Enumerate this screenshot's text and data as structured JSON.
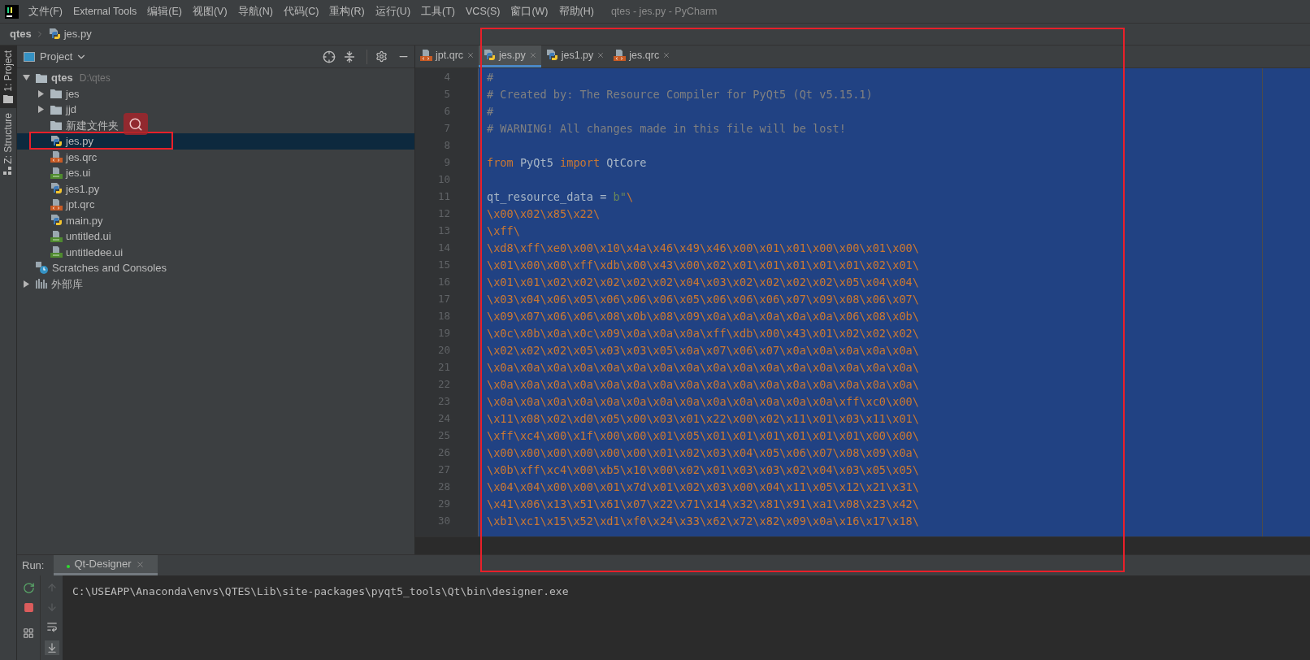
{
  "menu_bar": {
    "items": [
      "文件(F)",
      "External Tools",
      "编辑(E)",
      "视图(V)",
      "导航(N)",
      "代码(C)",
      "重构(R)",
      "运行(U)",
      "工具(T)",
      "VCS(S)",
      "窗口(W)",
      "帮助(H)"
    ],
    "title": "qtes - jes.py - PyCharm"
  },
  "breadcrumb": [
    {
      "kind": "folder",
      "label": "qtes"
    },
    {
      "kind": "python",
      "label": "jes.py"
    }
  ],
  "tool_strip": [
    {
      "label": "1: Project",
      "selected": true
    },
    {
      "label": "Z: Structure",
      "selected": false
    }
  ],
  "project": {
    "title": "Project",
    "tree": [
      {
        "kind": "folder",
        "label": "qtes",
        "hint": "D:\\qtes",
        "expanded": true,
        "selected": false,
        "children": [
          {
            "kind": "folder",
            "label": "jes",
            "expanded": false,
            "selected": false
          },
          {
            "kind": "folder",
            "label": "jjd",
            "expanded": false,
            "selected": false
          },
          {
            "kind": "folder",
            "label": "新建文件夹",
            "selected": false
          },
          {
            "kind": "python",
            "label": "jes.py",
            "selected": true
          },
          {
            "kind": "qrc",
            "label": "jes.qrc",
            "selected": false
          },
          {
            "kind": "ui",
            "label": "jes.ui",
            "selected": false
          },
          {
            "kind": "python",
            "label": "jes1.py",
            "selected": false
          },
          {
            "kind": "qrc",
            "label": "jpt.qrc",
            "selected": false
          },
          {
            "kind": "python",
            "label": "main.py",
            "selected": false
          },
          {
            "kind": "ui",
            "label": "untitled.ui",
            "selected": false
          },
          {
            "kind": "ui",
            "label": "untitledee.ui",
            "selected": false
          }
        ]
      },
      {
        "kind": "scratches",
        "label": "Scratches and Consoles",
        "selected": false
      },
      {
        "kind": "library",
        "label": "外部库",
        "expanded": false,
        "selected": false
      }
    ]
  },
  "editor": {
    "tabs": [
      {
        "kind": "qrc",
        "label": "jpt.qrc",
        "selected": false
      },
      {
        "kind": "python",
        "label": "jes.py",
        "selected": true
      },
      {
        "kind": "python",
        "label": "jes1.py",
        "selected": false
      },
      {
        "kind": "qrc",
        "label": "jes.qrc",
        "selected": false
      }
    ],
    "lines": [
      {
        "number": "4",
        "tokens": [
          {
            "kind": "comment",
            "text": "#"
          }
        ]
      },
      {
        "number": "5",
        "tokens": [
          {
            "kind": "comment",
            "text": "# Created by: The Resource Compiler for PyQt5 (Qt v5.15.1)"
          }
        ]
      },
      {
        "number": "6",
        "tokens": [
          {
            "kind": "comment",
            "text": "#"
          }
        ]
      },
      {
        "number": "7",
        "tokens": [
          {
            "kind": "comment",
            "text": "# WARNING! All changes made in this file will be lost!"
          }
        ]
      },
      {
        "number": "8"
      },
      {
        "number": "9",
        "tokens": [
          {
            "kind": "keyword",
            "text": "from"
          },
          {
            "kind": "plain",
            "text": " PyQt5 "
          },
          {
            "kind": "keyword",
            "text": "import"
          },
          {
            "kind": "plain",
            "text": " QtCore"
          }
        ]
      },
      {
        "number": "10"
      },
      {
        "number": "11",
        "tokens": [
          {
            "kind": "plain",
            "text": "qt_resource_data = "
          },
          {
            "kind": "string",
            "text": "b\""
          },
          {
            "kind": "escape",
            "text": "\\"
          }
        ]
      },
      {
        "number": "12",
        "tokens": [
          {
            "kind": "escape",
            "text": "\\x00\\x02\\x85\\x22\\"
          }
        ]
      },
      {
        "number": "13",
        "tokens": [
          {
            "kind": "escape",
            "text": "\\xff\\"
          }
        ]
      },
      {
        "number": "14",
        "tokens": [
          {
            "kind": "escape",
            "text": "\\xd8\\xff\\xe0\\x00\\x10\\x4a\\x46\\x49\\x46\\x00\\x01\\x01\\x00\\x00\\x01\\x00\\"
          }
        ]
      },
      {
        "number": "15",
        "tokens": [
          {
            "kind": "escape",
            "text": "\\x01\\x00\\x00\\xff\\xdb\\x00\\x43\\x00\\x02\\x01\\x01\\x01\\x01\\x01\\x02\\x01\\"
          }
        ]
      },
      {
        "number": "16",
        "tokens": [
          {
            "kind": "escape",
            "text": "\\x01\\x01\\x02\\x02\\x02\\x02\\x02\\x04\\x03\\x02\\x02\\x02\\x02\\x05\\x04\\x04\\"
          }
        ]
      },
      {
        "number": "17",
        "tokens": [
          {
            "kind": "escape",
            "text": "\\x03\\x04\\x06\\x05\\x06\\x06\\x06\\x05\\x06\\x06\\x06\\x07\\x09\\x08\\x06\\x07\\"
          }
        ]
      },
      {
        "number": "18",
        "tokens": [
          {
            "kind": "escape",
            "text": "\\x09\\x07\\x06\\x06\\x08\\x0b\\x08\\x09\\x0a\\x0a\\x0a\\x0a\\x0a\\x06\\x08\\x0b\\"
          }
        ]
      },
      {
        "number": "19",
        "tokens": [
          {
            "kind": "escape",
            "text": "\\x0c\\x0b\\x0a\\x0c\\x09\\x0a\\x0a\\x0a\\xff\\xdb\\x00\\x43\\x01\\x02\\x02\\x02\\"
          }
        ]
      },
      {
        "number": "20",
        "tokens": [
          {
            "kind": "escape",
            "text": "\\x02\\x02\\x02\\x05\\x03\\x03\\x05\\x0a\\x07\\x06\\x07\\x0a\\x0a\\x0a\\x0a\\x0a\\"
          }
        ]
      },
      {
        "number": "21",
        "tokens": [
          {
            "kind": "escape",
            "text": "\\x0a\\x0a\\x0a\\x0a\\x0a\\x0a\\x0a\\x0a\\x0a\\x0a\\x0a\\x0a\\x0a\\x0a\\x0a\\x0a\\"
          }
        ]
      },
      {
        "number": "22",
        "tokens": [
          {
            "kind": "escape",
            "text": "\\x0a\\x0a\\x0a\\x0a\\x0a\\x0a\\x0a\\x0a\\x0a\\x0a\\x0a\\x0a\\x0a\\x0a\\x0a\\x0a\\"
          }
        ]
      },
      {
        "number": "23",
        "tokens": [
          {
            "kind": "escape",
            "text": "\\x0a\\x0a\\x0a\\x0a\\x0a\\x0a\\x0a\\x0a\\x0a\\x0a\\x0a\\x0a\\x0a\\xff\\xc0\\x00\\"
          }
        ]
      },
      {
        "number": "24",
        "tokens": [
          {
            "kind": "escape",
            "text": "\\x11\\x08\\x02\\xd0\\x05\\x00\\x03\\x01\\x22\\x00\\x02\\x11\\x01\\x03\\x11\\x01\\"
          }
        ]
      },
      {
        "number": "25",
        "tokens": [
          {
            "kind": "escape",
            "text": "\\xff\\xc4\\x00\\x1f\\x00\\x00\\x01\\x05\\x01\\x01\\x01\\x01\\x01\\x01\\x00\\x00\\"
          }
        ]
      },
      {
        "number": "26",
        "tokens": [
          {
            "kind": "escape",
            "text": "\\x00\\x00\\x00\\x00\\x00\\x00\\x01\\x02\\x03\\x04\\x05\\x06\\x07\\x08\\x09\\x0a\\"
          }
        ]
      },
      {
        "number": "27",
        "tokens": [
          {
            "kind": "escape",
            "text": "\\x0b\\xff\\xc4\\x00\\xb5\\x10\\x00\\x02\\x01\\x03\\x03\\x02\\x04\\x03\\x05\\x05\\"
          }
        ]
      },
      {
        "number": "28",
        "tokens": [
          {
            "kind": "escape",
            "text": "\\x04\\x04\\x00\\x00\\x01\\x7d\\x01\\x02\\x03\\x00\\x04\\x11\\x05\\x12\\x21\\x31\\"
          }
        ]
      },
      {
        "number": "29",
        "tokens": [
          {
            "kind": "escape",
            "text": "\\x41\\x06\\x13\\x51\\x61\\x07\\x22\\x71\\x14\\x32\\x81\\x91\\xa1\\x08\\x23\\x42\\"
          }
        ]
      },
      {
        "number": "30",
        "tokens": [
          {
            "kind": "escape",
            "text": "\\xb1\\xc1\\x15\\x52\\xd1\\xf0\\x24\\x33\\x62\\x72\\x82\\x09\\x0a\\x16\\x17\\x18\\"
          }
        ]
      }
    ]
  },
  "run_panel": {
    "label": "Run:",
    "tabs": [
      {
        "label": "Qt-Designer",
        "selected": true
      }
    ],
    "console": [
      "C:\\USEAPP\\Anaconda\\envs\\QTES\\Lib\\site-packages\\pyqt5_tools\\Qt\\bin\\designer.exe"
    ]
  }
}
